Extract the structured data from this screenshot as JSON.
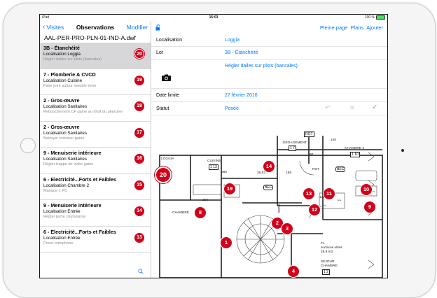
{
  "status": {
    "device": "iPad",
    "time": "16:03",
    "battery": "100 %"
  },
  "sidebar": {
    "back_label": "Visites",
    "title": "Observations",
    "edit_label": "Modifier",
    "file": "AAL-PER-PRO-PLN-01-IND-A.dwf",
    "items": [
      {
        "title": "3B - Étanchéité",
        "location": "Localisation Loggia",
        "desc": "Régler dalles sur plots (bancales)",
        "num": "20"
      },
      {
        "title": "7 - Plomberie & CVCD",
        "location": "Localisation Cuisine",
        "desc": "Faire joint autour meuble évier",
        "num": "19"
      },
      {
        "title": "2 - Gros-œuvre",
        "location": "Localisation Sanitaires",
        "desc": "Rebouchement CF gaine au droit du plancher",
        "num": "18"
      },
      {
        "title": "2 - Gros-œuvre",
        "location": "Localisation Sanitaires",
        "desc": "Nettoyer Intérieur gaine",
        "num": "17"
      },
      {
        "title": "9 - Menuiserie intérieure",
        "location": "Localisation Sanitaires",
        "desc": "Régler trappe de visite gaine",
        "num": "16"
      },
      {
        "title": "6 - Electricité...Forts et Faibles",
        "location": "Localisation Chambre 2",
        "desc": "Manque 1 PC",
        "num": "15"
      },
      {
        "title": "9 - Menuiserie intérieure",
        "location": "Localisation Entrée",
        "desc": "Régler porte coulissante",
        "num": "14"
      },
      {
        "title": "6 - Electricité...Forts et Faibles",
        "location": "Localisation Entrée",
        "desc": "Poser interphone",
        "num": "13"
      }
    ]
  },
  "topbar": {
    "full_page": "Pleine page",
    "plans": "Plans",
    "add": "Ajouter"
  },
  "form": {
    "loc_label": "Localisation",
    "loc_value": "Loggia",
    "lot_label": "Lot",
    "lot_value": "3B - Étanchéité",
    "desc_value": "Régler dalles sur plots (bancales)",
    "date_label": "Date limite",
    "date_value": "27 février 2016",
    "status_label": "Statut",
    "status_value": "Posée"
  },
  "plan": {
    "labels": {
      "loggia": "LOGGIA",
      "cuisine": "CUISINE",
      "cuisine_code": "1 13",
      "degagement": "DEGAGEMENT",
      "degagement_code": "1 7",
      "chambre2": "CHAMBRE 2",
      "chambre2_code": "1 10",
      "chambre": "CHAMBRE",
      "f1": "F1",
      "surfaces": "surfaces utiles",
      "area": "28.9 m2",
      "sejour": "SEJOUR",
      "sejour2": "CHAMBRE",
      "sejour_code": "1 2",
      "rgt": "RGT",
      "rgt2": "RGT",
      "bec": "BEC",
      "bec2": "BEC",
      "elec": "ELEC",
      "ll": "LL",
      "d380": "380",
      "d264": "264",
      "d158": "158",
      "d126": "126",
      "d80": "80",
      "d1362": "36.62",
      "d140": "140"
    },
    "pins": [
      "20",
      "19",
      "14",
      "13",
      "12",
      "11",
      "10",
      "9",
      "8",
      "2",
      "3",
      "1",
      "4"
    ]
  }
}
